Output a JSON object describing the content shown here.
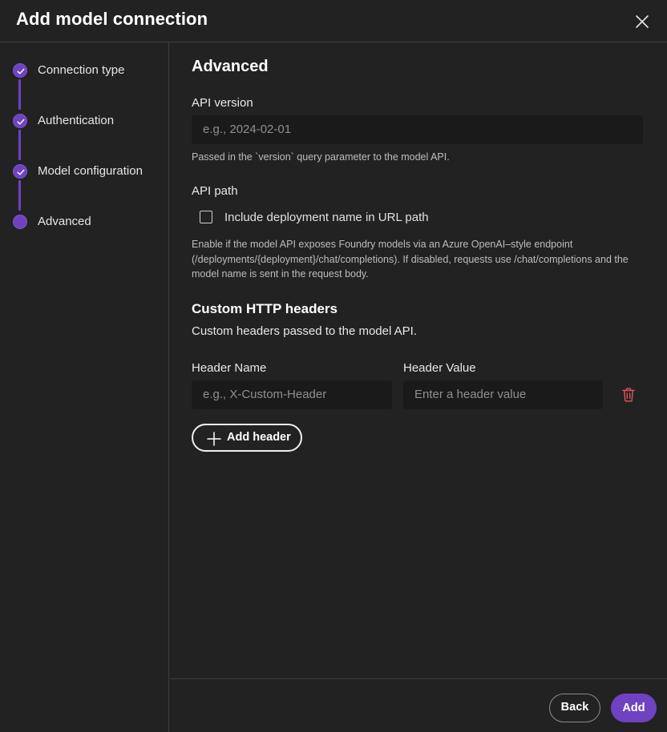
{
  "dialog": {
    "title": "Add model connection",
    "close_icon": "close-icon"
  },
  "steps": [
    {
      "label": "Connection type",
      "state": "completed",
      "icon": "check-icon"
    },
    {
      "label": "Authentication",
      "state": "completed",
      "icon": "check-icon"
    },
    {
      "label": "Model configuration",
      "state": "completed",
      "icon": "check-icon"
    },
    {
      "label": "Advanced",
      "state": "current",
      "icon": "none"
    }
  ],
  "advanced": {
    "title": "Advanced",
    "api_version": {
      "label": "API version",
      "value": "",
      "placeholder": "e.g., 2024-02-01",
      "help": "Passed in the `version` query parameter to the model API."
    },
    "api_path": {
      "label": "API path",
      "checkbox_label": "Include deployment name in URL path",
      "checked": false,
      "help": "Enable if the model API exposes Foundry models via an Azure OpenAI–style endpoint (/deployments/{deployment}/chat/completions). If disabled, requests use /chat/completions and the model name is sent in the request body."
    },
    "custom_headers": {
      "title": "Custom HTTP headers",
      "description": "Custom headers passed to the model API.",
      "name_label": "Header Name",
      "value_label": "Header Value",
      "rows": [
        {
          "name": "",
          "name_placeholder": "e.g., X-Custom-Header",
          "value": "",
          "value_placeholder": "Enter a header value",
          "delete_icon": "trash-icon"
        }
      ],
      "add_label": "Add header",
      "add_icon": "plus-icon"
    }
  },
  "footer": {
    "back_label": "Back",
    "add_label": "Add"
  },
  "colors": {
    "accent": "#6f42c1",
    "background": "#222222",
    "input_background": "#1a1a1a",
    "danger": "#e0555a"
  }
}
